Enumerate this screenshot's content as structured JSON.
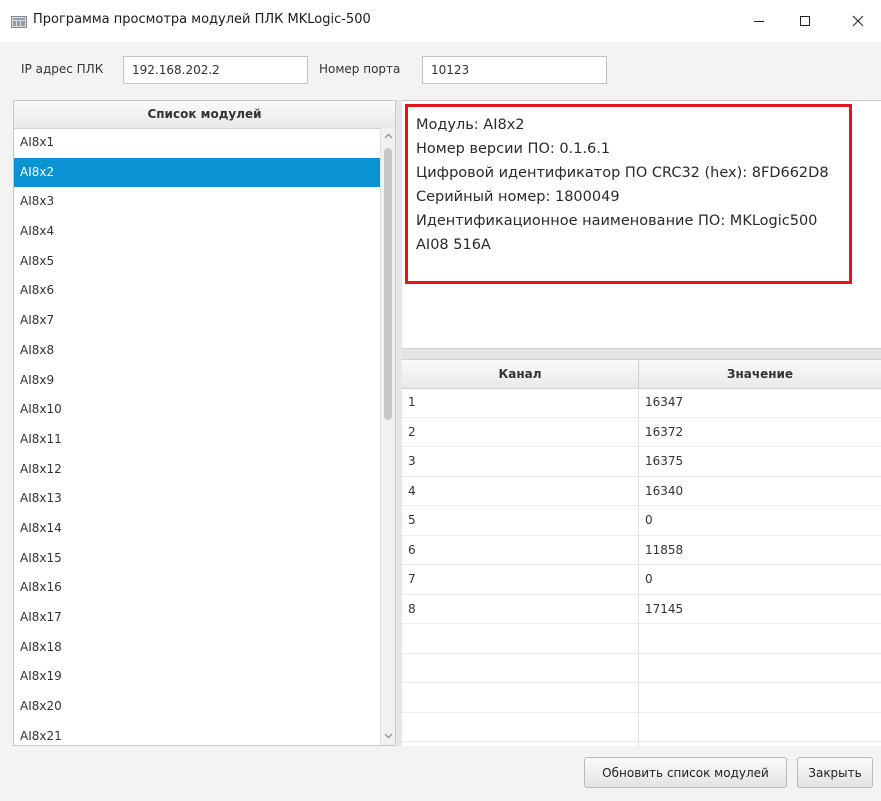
{
  "window": {
    "title": "Программа просмотра модулей ПЛК MKLogic-500"
  },
  "connection": {
    "ip_label": "IP адрес ПЛК",
    "ip_value": "192.168.202.2",
    "port_label": "Номер порта",
    "port_value": "10123"
  },
  "modules": {
    "header": "Список модулей",
    "items": [
      "AI8x1",
      "AI8x2",
      "AI8x3",
      "AI8x4",
      "AI8x5",
      "AI8x6",
      "AI8x7",
      "AI8x8",
      "AI8x9",
      "AI8x10",
      "AI8x11",
      "AI8x12",
      "AI8x13",
      "AI8x14",
      "AI8x15",
      "AI8x16",
      "AI8x17",
      "AI8x18",
      "AI8x19",
      "AI8x20",
      "AI8x21"
    ],
    "selected": "AI8x2"
  },
  "info": {
    "lines": [
      "Модуль: AI8x2",
      "Номер версии ПО: 0.1.6.1",
      "Цифровой идентификатор ПО CRC32 (hex): 8FD662D8",
      "Серийный номер: 1800049",
      "Идентификационное наименование ПО: MKLogic500",
      "AI08 516A"
    ]
  },
  "channels": {
    "headers": [
      "Канал",
      "Значение"
    ],
    "rows": [
      [
        "1",
        "16347"
      ],
      [
        "2",
        "16372"
      ],
      [
        "3",
        "16375"
      ],
      [
        "4",
        "16340"
      ],
      [
        "5",
        "0"
      ],
      [
        "6",
        "11858"
      ],
      [
        "7",
        "0"
      ],
      [
        "8",
        "17145"
      ],
      [
        "",
        ""
      ],
      [
        "",
        ""
      ],
      [
        "",
        ""
      ],
      [
        "",
        ""
      ]
    ]
  },
  "buttons": {
    "refresh": "Обновить список модулей",
    "close": "Закрыть"
  },
  "colors": {
    "selection": "#0a93d2",
    "highlight_border": "#e5131b"
  }
}
